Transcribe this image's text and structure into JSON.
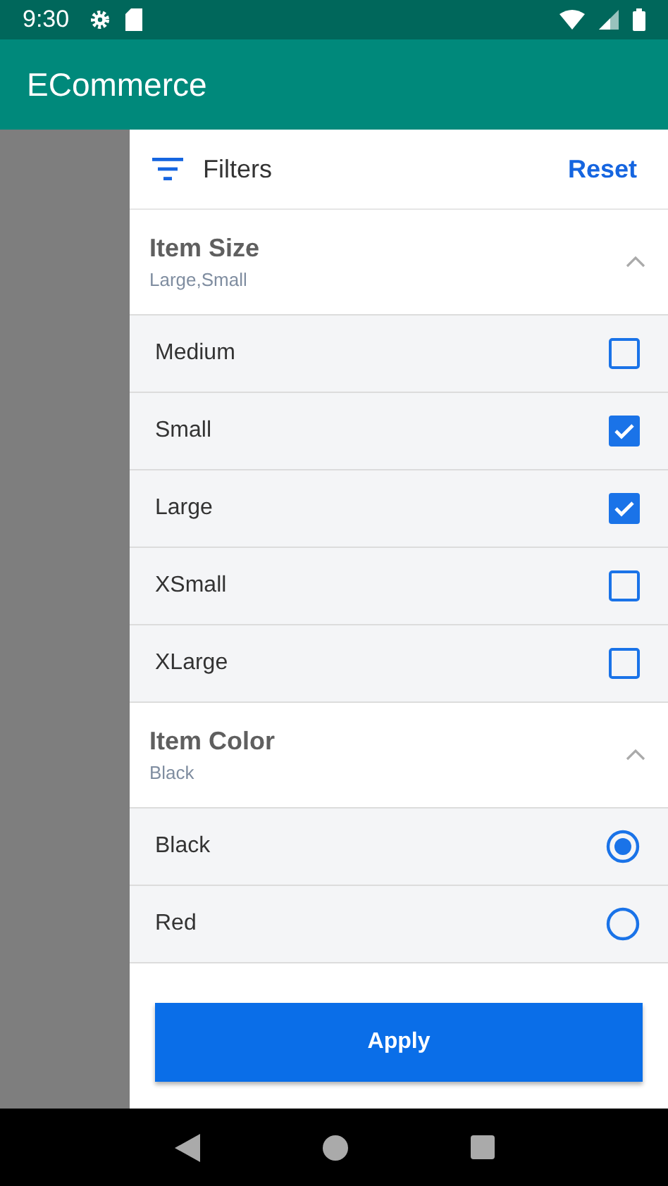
{
  "status_bar": {
    "time": "9:30"
  },
  "app_bar": {
    "title": "ECommerce"
  },
  "drawer": {
    "title": "Filters",
    "reset": "Reset",
    "sections": [
      {
        "title": "Item Size",
        "summary": "Large,Small",
        "expanded": true,
        "kind": "checkbox",
        "options": [
          {
            "label": "Medium",
            "selected": false
          },
          {
            "label": "Small",
            "selected": true
          },
          {
            "label": "Large",
            "selected": true
          },
          {
            "label": "XSmall",
            "selected": false
          },
          {
            "label": "XLarge",
            "selected": false
          }
        ]
      },
      {
        "title": "Item Color",
        "summary": "Black",
        "expanded": true,
        "kind": "radio",
        "options": [
          {
            "label": "Black",
            "selected": true
          },
          {
            "label": "Red",
            "selected": false
          }
        ]
      }
    ],
    "apply": "Apply"
  }
}
